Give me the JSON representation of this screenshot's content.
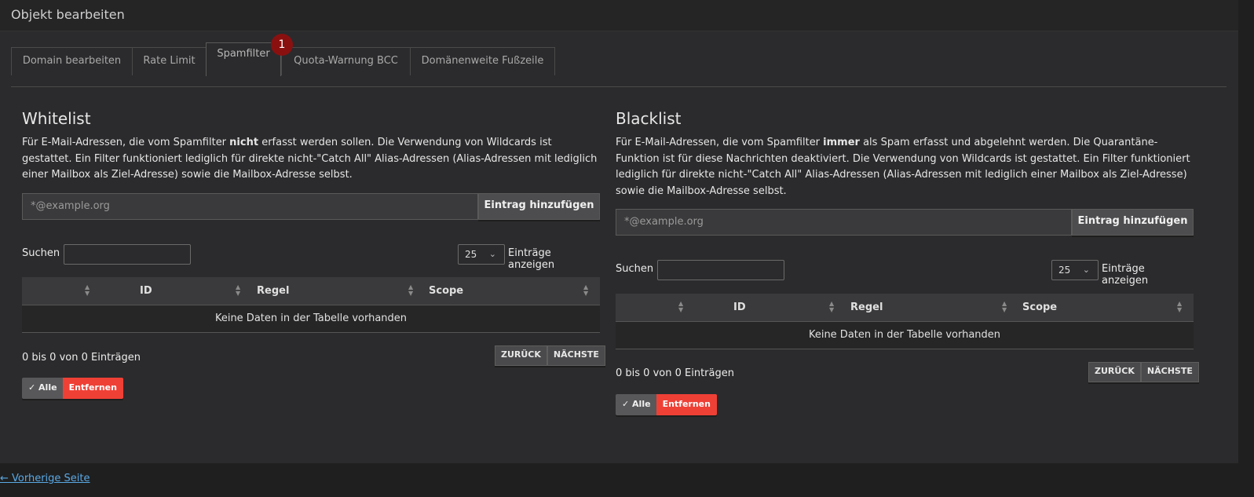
{
  "header": {
    "title": "Objekt bearbeiten"
  },
  "tabs": [
    {
      "label": "Domain bearbeiten",
      "active": false
    },
    {
      "label": "Rate Limit",
      "active": false
    },
    {
      "label": "Spamfilter",
      "active": true
    },
    {
      "label": "Quota-Warnung BCC",
      "active": false
    },
    {
      "label": "Domänenweite Fußzeile",
      "active": false
    }
  ],
  "badge": "1",
  "whitelist": {
    "title": "Whitelist",
    "desc_pre": "Für E-Mail-Adressen, die vom Spamfilter ",
    "desc_bold": "nicht",
    "desc_post": " erfasst werden sollen. Die Verwendung von Wildcards ist gestattet. Ein Filter funktioniert lediglich für direkte nicht-\"Catch All\" Alias-Adressen (Alias-Adressen mit lediglich einer Mailbox als Ziel-Adresse) sowie die Mailbox-Adresse selbst.",
    "input_placeholder": "*@example.org",
    "add_label": "Eintrag hinzufügen",
    "search_label": "Suchen",
    "length_value": "25",
    "length_label": "Einträge anzeigen",
    "columns": [
      "",
      "ID",
      "Regel",
      "Scope"
    ],
    "empty_text": "Keine Daten in der Tabelle vorhanden",
    "info_text": "0 bis 0 von 0 Einträgen",
    "prev_label": "ZURÜCK",
    "next_label": "NÄCHSTE",
    "all_label": "Alle",
    "remove_label": "Entfernen"
  },
  "blacklist": {
    "title": "Blacklist",
    "desc_pre": "Für E-Mail-Adressen, die vom Spamfilter ",
    "desc_bold": "immer",
    "desc_post": " als Spam erfasst und abgelehnt werden. Die Quarantäne-Funktion ist für diese Nachrichten deaktiviert. Die Verwendung von Wildcards ist gestattet. Ein Filter funktioniert lediglich für direkte nicht-\"Catch All\" Alias-Adressen (Alias-Adressen mit lediglich einer Mailbox als Ziel-Adresse) sowie die Mailbox-Adresse selbst.",
    "input_placeholder": "*@example.org",
    "add_label": "Eintrag hinzufügen",
    "search_label": "Suchen",
    "length_value": "25",
    "length_label": "Einträge anzeigen",
    "columns": [
      "",
      "ID",
      "Regel",
      "Scope"
    ],
    "empty_text": "Keine Daten in der Tabelle vorhanden",
    "info_text": "0 bis 0 von 0 Einträgen",
    "prev_label": "ZURÜCK",
    "next_label": "NÄCHSTE",
    "all_label": "Alle",
    "remove_label": "Entfernen"
  },
  "footer": {
    "back_link": "← Vorherige Seite"
  },
  "colors": {
    "accent_link": "#5aa9e6",
    "danger": "#ef4036",
    "badge": "#8a1010"
  },
  "icons": {
    "sort": "sort-arrows-icon",
    "check": "double-check-icon",
    "select": "chevron-down-icon"
  }
}
